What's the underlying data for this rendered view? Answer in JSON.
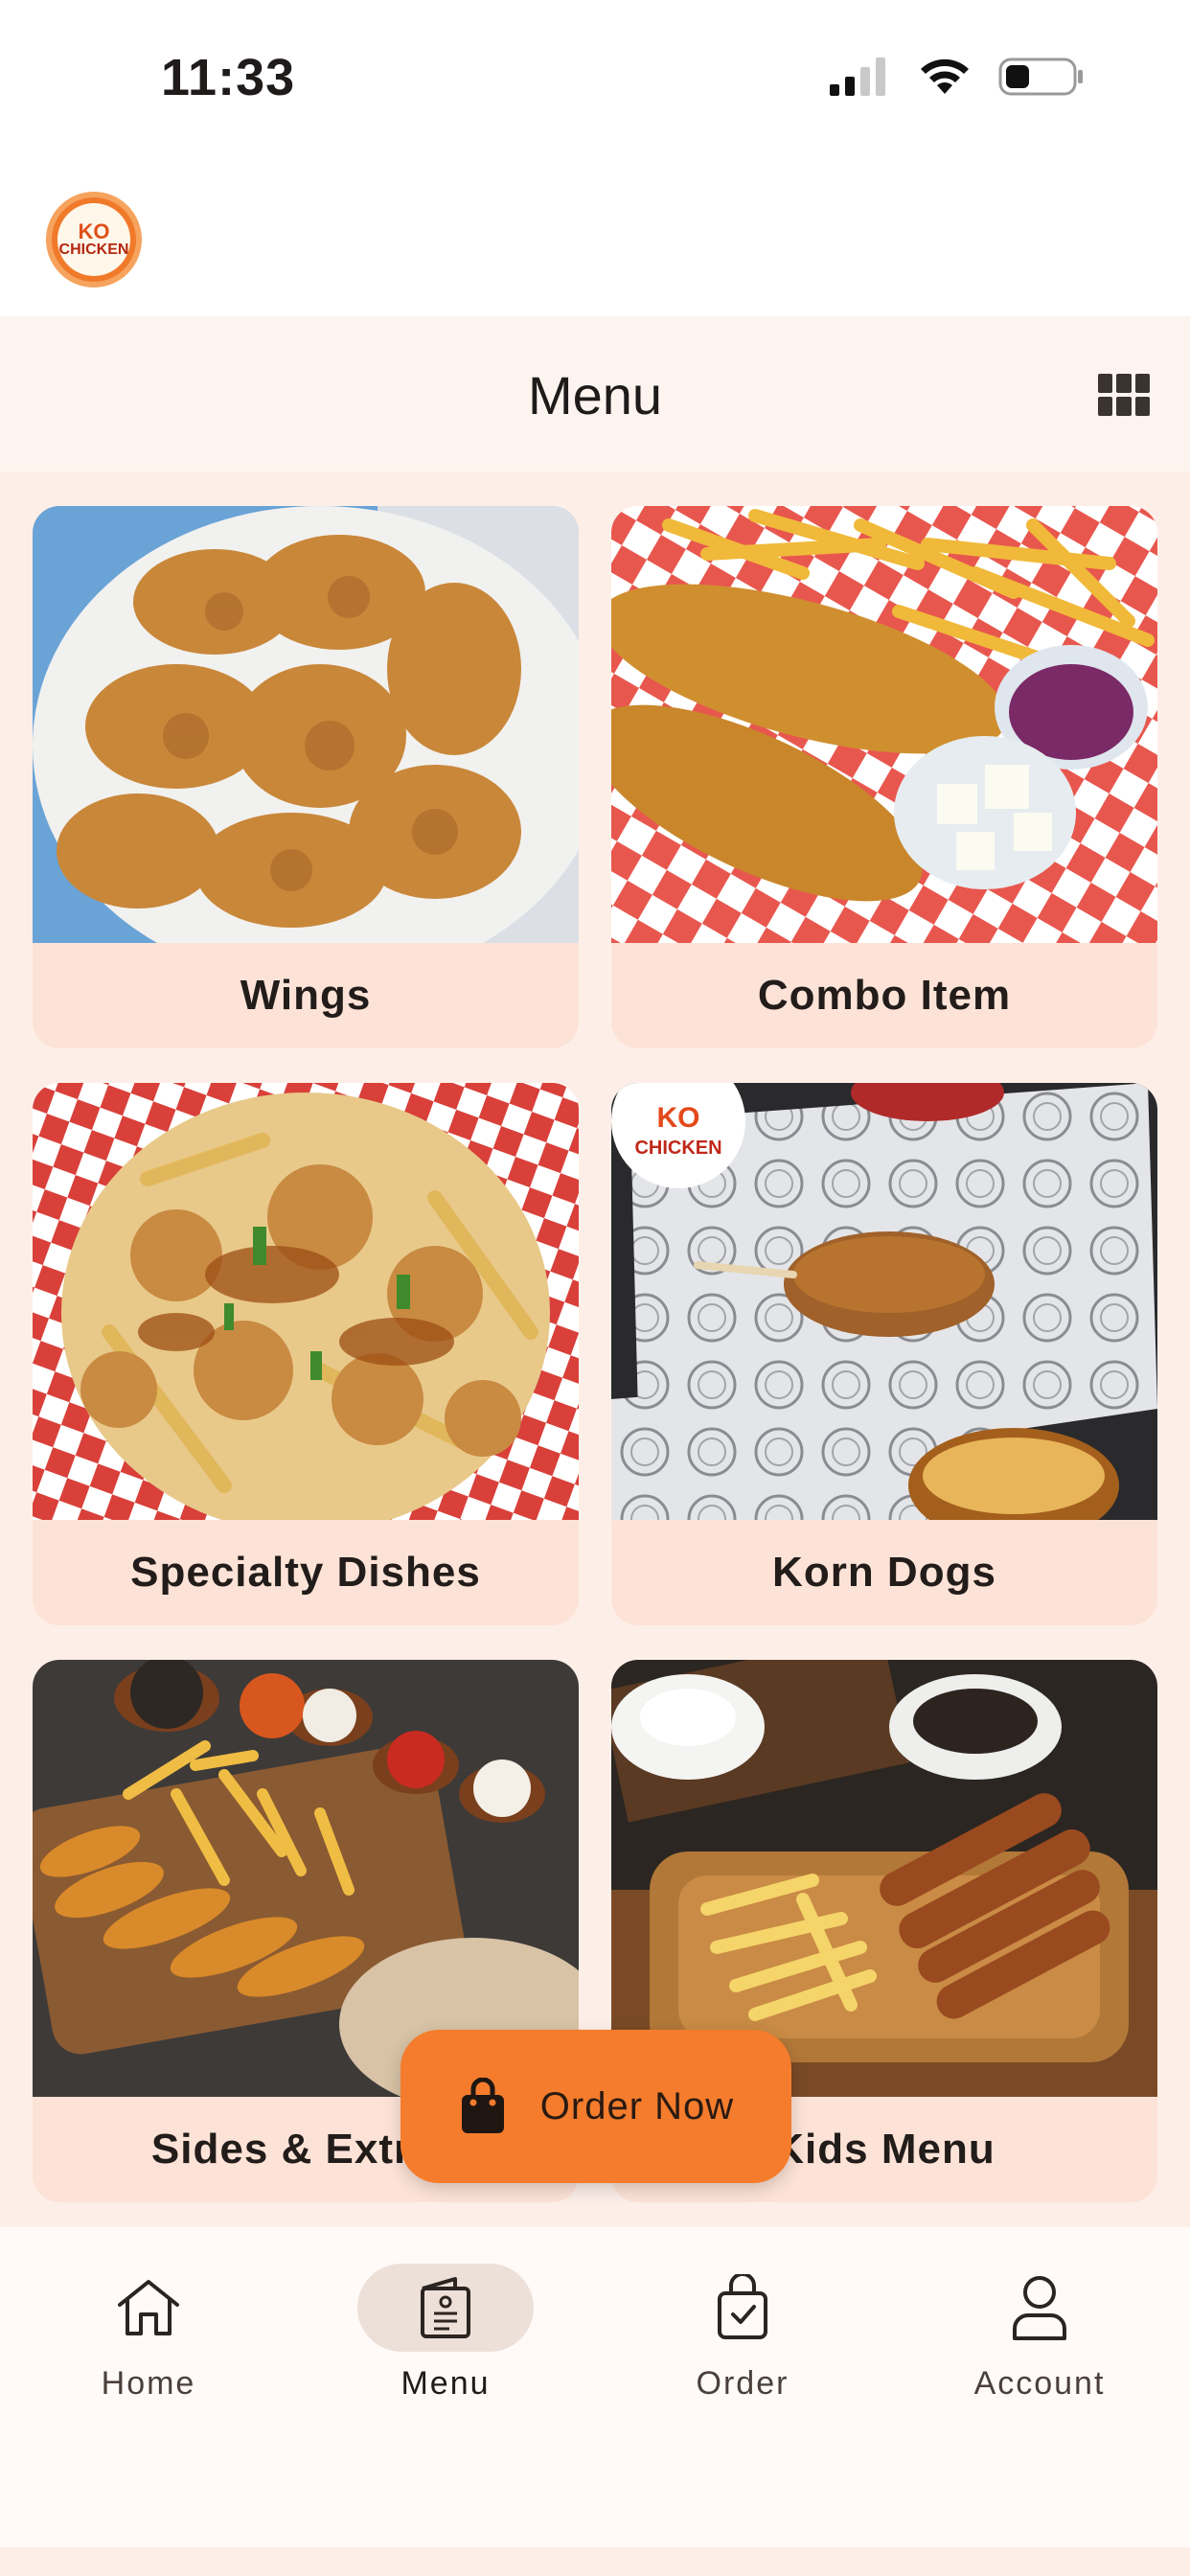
{
  "status_bar": {
    "time": "11:33"
  },
  "header": {
    "logo_text_top": "KO",
    "logo_text_bottom": "CHICKEN"
  },
  "title_bar": {
    "title": "Menu"
  },
  "menu": {
    "items": [
      {
        "label": "Wings"
      },
      {
        "label": "Combo Item"
      },
      {
        "label": "Specialty Dishes"
      },
      {
        "label": "Korn Dogs"
      },
      {
        "label": "Sides & Extras"
      },
      {
        "label": "Kids Menu"
      }
    ]
  },
  "fab": {
    "label": "Order Now"
  },
  "bottom_nav": {
    "items": [
      {
        "label": "Home",
        "icon": "home-icon"
      },
      {
        "label": "Menu",
        "icon": "menu-book-icon"
      },
      {
        "label": "Order",
        "icon": "bag-check-icon"
      },
      {
        "label": "Account",
        "icon": "person-icon"
      }
    ],
    "active": "Menu"
  },
  "colors": {
    "accent": "#f47c2c",
    "card_label_bg": "#fde3d7",
    "page_bg": "#fdefe8",
    "active_nav_pill": "#ece0d9"
  }
}
